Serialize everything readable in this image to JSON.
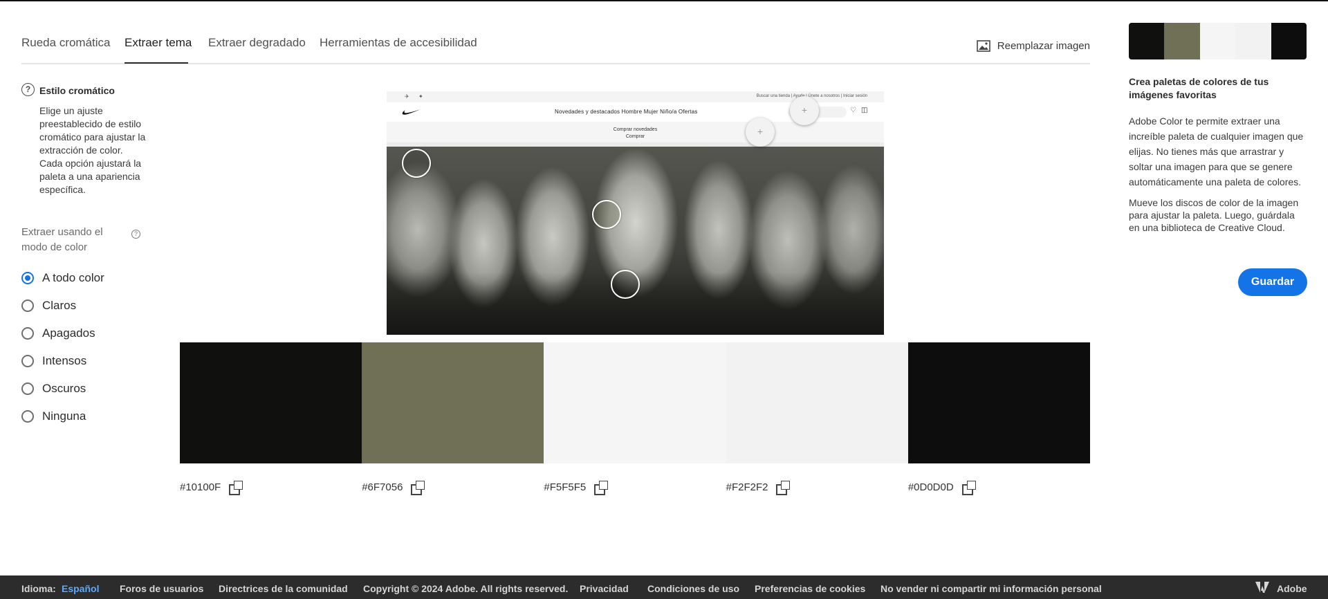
{
  "tabs": [
    "Rueda cromática",
    "Extraer tema",
    "Extraer degradado",
    "Herramientas de accesibilidad"
  ],
  "active_tab": "Extraer tema",
  "replace_image_label": "Reemplazar imagen",
  "left": {
    "help_glyph": "?",
    "style_title": "Estilo cromático",
    "style_desc": "Elige un ajuste preestablecido de estilo cromático para ajustar la extracción de color. Cada opción ajustará la paleta a una apariencia específica.",
    "mode_label": "Extraer usando el modo de color",
    "mode_help_glyph": "?",
    "options": [
      "A todo color",
      "Claros",
      "Apagados",
      "Intensos",
      "Oscuros",
      "Ninguna"
    ],
    "selected": "A todo color"
  },
  "image": {
    "top_bar_text": "Buscar una tienda  |  Ayuda  |  Únete a nosotros  |  Iniciar sesión",
    "nav_links": "Novedades y destacados    Hombre    Mujer    Niño/a    Ofertas",
    "banner_line1": "Comprar novedades",
    "banner_line2": "Comprar",
    "plus_glyph": "+"
  },
  "palette": [
    {
      "hex": "#10100F",
      "color": "#10100F"
    },
    {
      "hex": "#6F7056",
      "color": "#6F7056"
    },
    {
      "hex": "#F5F5F5",
      "color": "#F5F5F5"
    },
    {
      "hex": "#F2F2F2",
      "color": "#F2F2F2"
    },
    {
      "hex": "#0D0D0D",
      "color": "#0D0D0D"
    }
  ],
  "right": {
    "title": "Crea paletas de colores de tus imágenes favoritas",
    "p1": "Adobe Color te permite extraer una increíble paleta de cualquier imagen que elijas. No tienes más que arrastrar y soltar una imagen para que se genere automáticamente una paleta de colores.",
    "p2": "Mueve los discos de color de la imagen para ajustar la paleta. Luego, guárdala en una biblioteca de Creative Cloud.",
    "save_label": "Guardar"
  },
  "footer": {
    "language_label": "Idioma:",
    "language_value": "Español",
    "links": [
      "Foros de usuarios",
      "Directrices de la comunidad",
      "Copyright © 2024 Adobe. All rights reserved.",
      "Privacidad",
      "Condiciones de uso",
      "Preferencias de cookies",
      "No vender ni compartir mi información personal"
    ],
    "brand": "Adobe"
  },
  "accent_color": "#1473E6"
}
